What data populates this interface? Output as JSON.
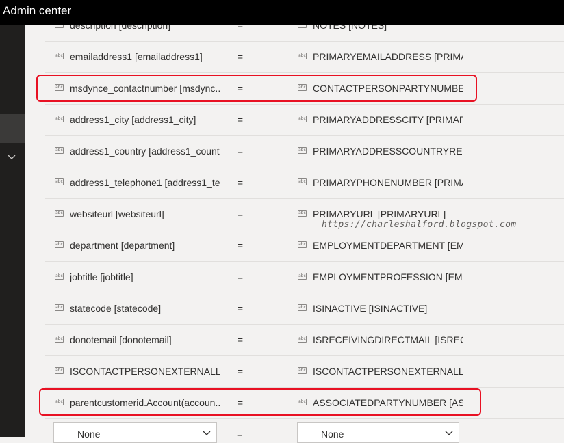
{
  "app": {
    "title": "Admin center"
  },
  "field_icon": "abc-field-icon",
  "rows": [
    {
      "source": "description [description]",
      "operator": "=",
      "target": "NOTES [NOTES]"
    },
    {
      "source": "emailaddress1 [emailaddress1]",
      "operator": "=",
      "target": "PRIMARYEMAILADDRESS [PRIMA..."
    },
    {
      "source": "msdynce_contactnumber [msdync...",
      "operator": "=",
      "target": "CONTACTPERSONPARTYNUMBER ..."
    },
    {
      "source": "address1_city [address1_city]",
      "operator": "=",
      "target": "PRIMARYADDRESSCITY [PRIMARY..."
    },
    {
      "source": "address1_country [address1_count...",
      "operator": "=",
      "target": "PRIMARYADDRESSCOUNTRYREGI..."
    },
    {
      "source": "address1_telephone1 [address1_te...",
      "operator": "=",
      "target": "PRIMARYPHONENUMBER [PRIMA..."
    },
    {
      "source": "websiteurl [websiteurl]",
      "operator": "=",
      "target": "PRIMARYURL [PRIMARYURL]"
    },
    {
      "source": "department [department]",
      "operator": "=",
      "target": "EMPLOYMENTDEPARTMENT [EMP..."
    },
    {
      "source": "jobtitle [jobtitle]",
      "operator": "=",
      "target": "EMPLOYMENTPROFESSION [EMPL..."
    },
    {
      "source": "statecode [statecode]",
      "operator": "=",
      "target": "ISINACTIVE [ISINACTIVE]"
    },
    {
      "source": "donotemail [donotemail]",
      "operator": "=",
      "target": "ISRECEIVINGDIRECTMAIL [ISRECEI..."
    },
    {
      "source": "ISCONTACTPERSONEXTERNALLY...",
      "operator": "=",
      "target": "ISCONTACTPERSONEXTERNALLY..."
    },
    {
      "source": "parentcustomerid.Account(accoun...",
      "operator": "=",
      "target": "ASSOCIATEDPARTYNUMBER [ASS..."
    }
  ],
  "new_row": {
    "source_value": "None",
    "operator": "=",
    "target_value": "None"
  },
  "watermark": "https://charleshalford.blogspot.com",
  "colors": {
    "highlight": "#e81123",
    "titlebar": "#000000",
    "nav": "#201f1e"
  }
}
